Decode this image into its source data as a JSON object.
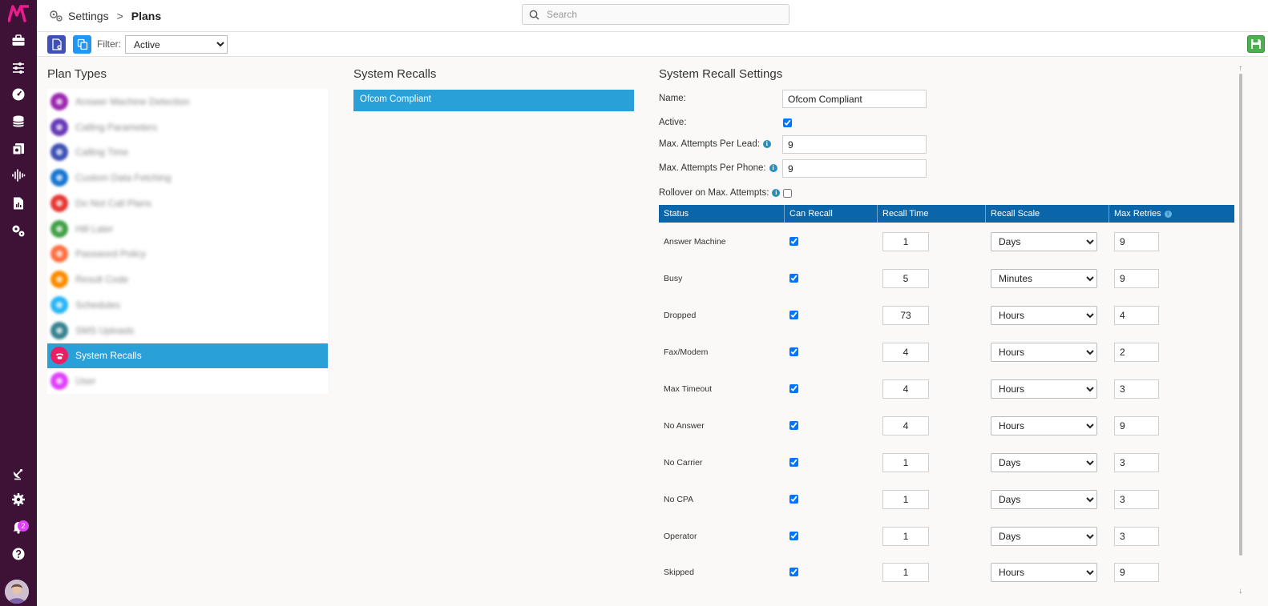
{
  "header": {
    "breadcrumb_root": "Settings",
    "breadcrumb_sep": ">",
    "breadcrumb_current": "Plans",
    "search_placeholder": "Search"
  },
  "toolbar": {
    "filter_label": "Filter:",
    "filter_value": "Active",
    "filter_options": [
      "Active"
    ]
  },
  "notifications_count": "2",
  "plan_types": {
    "title": "Plan Types",
    "items": [
      {
        "label": "Answer Machine Detection",
        "color": "#9c27b0",
        "blurred": true
      },
      {
        "label": "Calling Parameters",
        "color": "#673ab7",
        "blurred": true
      },
      {
        "label": "Calling Time",
        "color": "#3f51b5",
        "blurred": true
      },
      {
        "label": "Custom Data Fetching",
        "color": "#1976d2",
        "blurred": true
      },
      {
        "label": "Do Not Call Plans",
        "color": "#e53935",
        "blurred": true
      },
      {
        "label": "Hill Later",
        "color": "#43a047",
        "blurred": true
      },
      {
        "label": "Password Policy",
        "color": "#ff7043",
        "blurred": true
      },
      {
        "label": "Result Code",
        "color": "#fb8c00",
        "blurred": true
      },
      {
        "label": "Schedules",
        "color": "#29b6f6",
        "blurred": true
      },
      {
        "label": "SMS Uploads",
        "color": "#37838f",
        "blurred": true
      },
      {
        "label": "System Recalls",
        "color": "#e91e63",
        "blurred": false
      },
      {
        "label": "User",
        "color": "#e040fb",
        "blurred": true
      }
    ]
  },
  "system_recalls": {
    "title": "System Recalls",
    "items": [
      "Ofcom Compliant"
    ]
  },
  "settings": {
    "title": "System Recall Settings",
    "name_label": "Name:",
    "name_value": "Ofcom Compliant",
    "active_label": "Active:",
    "active_checked": true,
    "max_lead_label": "Max. Attempts Per Lead:",
    "max_lead_value": "9",
    "max_phone_label": "Max. Attempts Per Phone:",
    "max_phone_value": "9",
    "rollover_label": "Rollover on Max. Attempts:",
    "rollover_checked": false
  },
  "table": {
    "columns": [
      "Status",
      "Can Recall",
      "Recall Time",
      "Recall Scale",
      "Max Retries"
    ],
    "scale_options": [
      "Minutes",
      "Hours",
      "Days"
    ],
    "rows": [
      {
        "status": "Answer Machine",
        "can_recall": true,
        "time": "1",
        "scale": "Days",
        "retries": "9"
      },
      {
        "status": "Busy",
        "can_recall": true,
        "time": "5",
        "scale": "Minutes",
        "retries": "9"
      },
      {
        "status": "Dropped",
        "can_recall": true,
        "time": "73",
        "scale": "Hours",
        "retries": "4"
      },
      {
        "status": "Fax/Modem",
        "can_recall": true,
        "time": "4",
        "scale": "Hours",
        "retries": "2"
      },
      {
        "status": "Max Timeout",
        "can_recall": true,
        "time": "4",
        "scale": "Hours",
        "retries": "3"
      },
      {
        "status": "No Answer",
        "can_recall": true,
        "time": "4",
        "scale": "Hours",
        "retries": "9"
      },
      {
        "status": "No Carrier",
        "can_recall": true,
        "time": "1",
        "scale": "Days",
        "retries": "3"
      },
      {
        "status": "No CPA",
        "can_recall": true,
        "time": "1",
        "scale": "Days",
        "retries": "3"
      },
      {
        "status": "Operator",
        "can_recall": true,
        "time": "1",
        "scale": "Days",
        "retries": "3"
      },
      {
        "status": "Skipped",
        "can_recall": true,
        "time": "1",
        "scale": "Hours",
        "retries": "9"
      }
    ]
  },
  "colors": {
    "rail": "#3d1236",
    "accent": "#2aa0d9",
    "table_header": "#0a66a8",
    "save": "#4caf50"
  }
}
